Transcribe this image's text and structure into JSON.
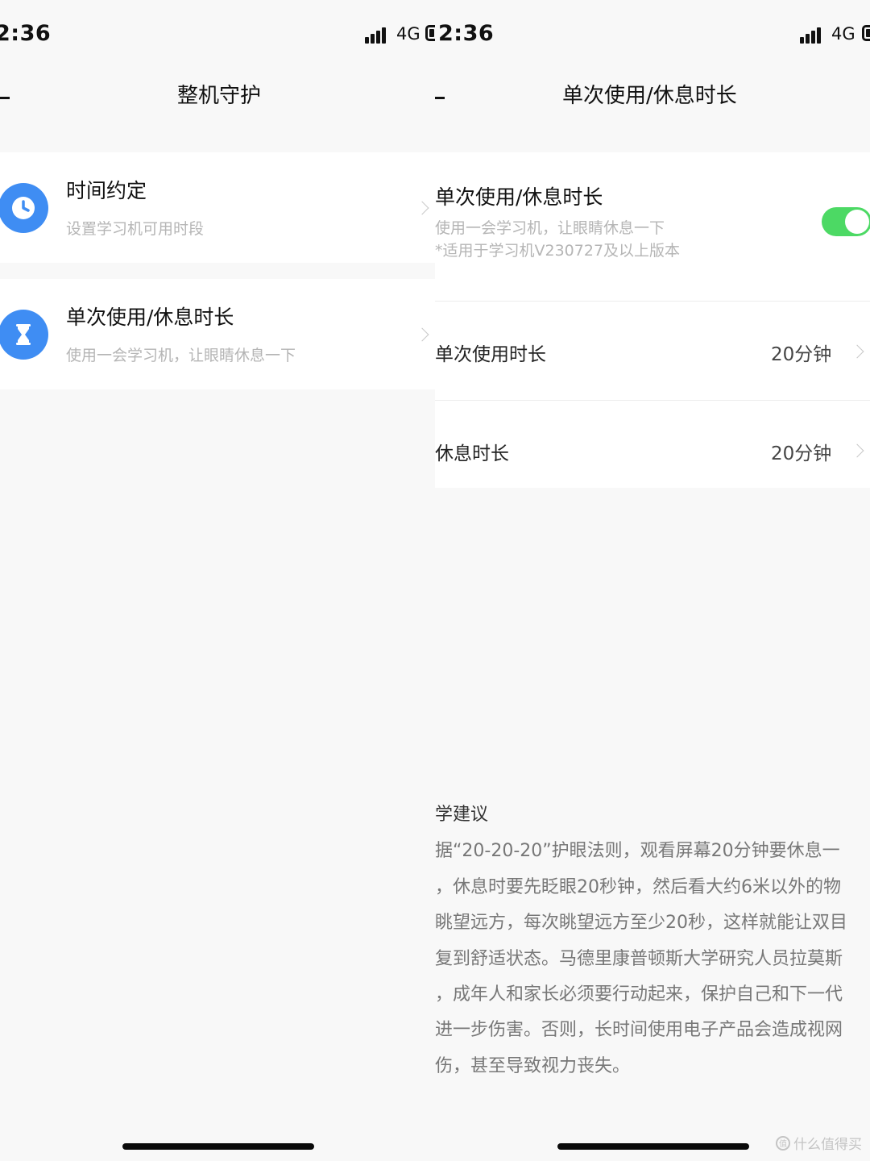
{
  "status_bar": {
    "time": "2:36",
    "network": "4G"
  },
  "left": {
    "title": "整机守护",
    "items": [
      {
        "title": "时间约定",
        "desc": "设置学习机可用时段",
        "icon": "clock-icon"
      },
      {
        "title": "单次使用/休息时长",
        "desc": "使用一会学习机，让眼睛休息一下",
        "icon": "hourglass-icon"
      }
    ]
  },
  "right": {
    "title": "单次使用/休息时长",
    "toggle_card": {
      "title": "单次使用/休息时长",
      "desc": "使用一会学习机，让眼睛休息一下",
      "note": "*适用于学习机V230727及以上版本",
      "enabled": true,
      "on_color": "#4cd964"
    },
    "rows": [
      {
        "label": "单次使用时长",
        "value": "20分钟"
      },
      {
        "label": "休息时长",
        "value": "20分钟"
      }
    ],
    "tips": {
      "title": "学建议",
      "lines": [
        "据“20-20-20”护眼法则，观看屏幕20分钟要休息一",
        "，休息时要先眨眼20秒钟，然后看大约6米以外的物",
        "眺望远方，每次眺望远方至少20秒，这样就能让双目",
        "复到舒适状态。马德里康普顿斯大学研究人员拉莫斯",
        "，成年人和家长必须要行动起来，保护自己和下一代",
        "进一步伤害。否则，长时间使用电子产品会造成视网",
        "伤，甚至导致视力丧失。"
      ]
    }
  },
  "watermark": "什么值得买",
  "colors": {
    "accent_blue": "#3f8df3",
    "toggle_green": "#4cd964",
    "background": "#f8f8f8"
  }
}
